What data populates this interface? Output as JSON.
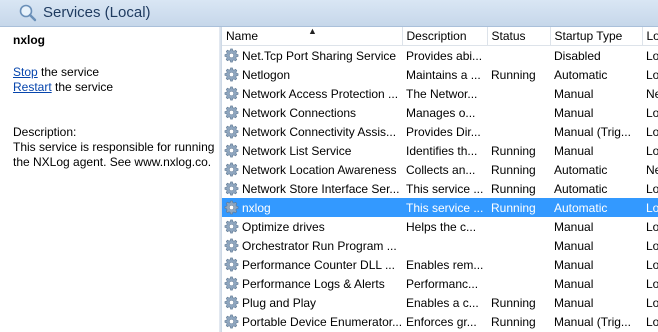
{
  "header": {
    "title": "Services (Local)"
  },
  "left_panel": {
    "service_name": "nxlog",
    "actions": [
      {
        "link": "Stop",
        "suffix": " the service"
      },
      {
        "link": "Restart",
        "suffix": " the service"
      }
    ],
    "description_label": "Description:",
    "description_text": "This service is responsible for running the NXLog agent. See www.nxlog.co."
  },
  "table": {
    "columns": [
      "Name",
      "Description",
      "Status",
      "Startup Type",
      "Log"
    ],
    "sort_indicator": "▲",
    "rows": [
      {
        "name": "Net.Tcp Port Sharing Service",
        "description": "Provides abi...",
        "status": "",
        "startup": "Disabled",
        "logon": "Loc"
      },
      {
        "name": "Netlogon",
        "description": "Maintains a ...",
        "status": "Running",
        "startup": "Automatic",
        "logon": "Loc"
      },
      {
        "name": "Network Access Protection ...",
        "description": "The Networ...",
        "status": "",
        "startup": "Manual",
        "logon": "Ne"
      },
      {
        "name": "Network Connections",
        "description": "Manages o...",
        "status": "",
        "startup": "Manual",
        "logon": "Loc"
      },
      {
        "name": "Network Connectivity Assis...",
        "description": "Provides Dir...",
        "status": "",
        "startup": "Manual (Trig...",
        "logon": "Loc"
      },
      {
        "name": "Network List Service",
        "description": "Identifies th...",
        "status": "Running",
        "startup": "Manual",
        "logon": "Loc"
      },
      {
        "name": "Network Location Awareness",
        "description": "Collects an...",
        "status": "Running",
        "startup": "Automatic",
        "logon": "Ne"
      },
      {
        "name": "Network Store Interface Ser...",
        "description": "This service ...",
        "status": "Running",
        "startup": "Automatic",
        "logon": "Loc"
      },
      {
        "name": "nxlog",
        "description": "This service ...",
        "status": "Running",
        "startup": "Automatic",
        "logon": "Loc",
        "selected": true
      },
      {
        "name": "Optimize drives",
        "description": "Helps the c...",
        "status": "",
        "startup": "Manual",
        "logon": "Loc"
      },
      {
        "name": "Orchestrator Run Program ...",
        "description": "",
        "status": "",
        "startup": "Manual",
        "logon": "Loc"
      },
      {
        "name": "Performance Counter DLL ...",
        "description": "Enables rem...",
        "status": "",
        "startup": "Manual",
        "logon": "Loc"
      },
      {
        "name": "Performance Logs & Alerts",
        "description": "Performanc...",
        "status": "",
        "startup": "Manual",
        "logon": "Loc"
      },
      {
        "name": "Plug and Play",
        "description": "Enables a c...",
        "status": "Running",
        "startup": "Manual",
        "logon": "Loc"
      },
      {
        "name": "Portable Device Enumerator...",
        "description": "Enforces gr...",
        "status": "Running",
        "startup": "Manual (Trig...",
        "logon": "Loc"
      }
    ]
  }
}
